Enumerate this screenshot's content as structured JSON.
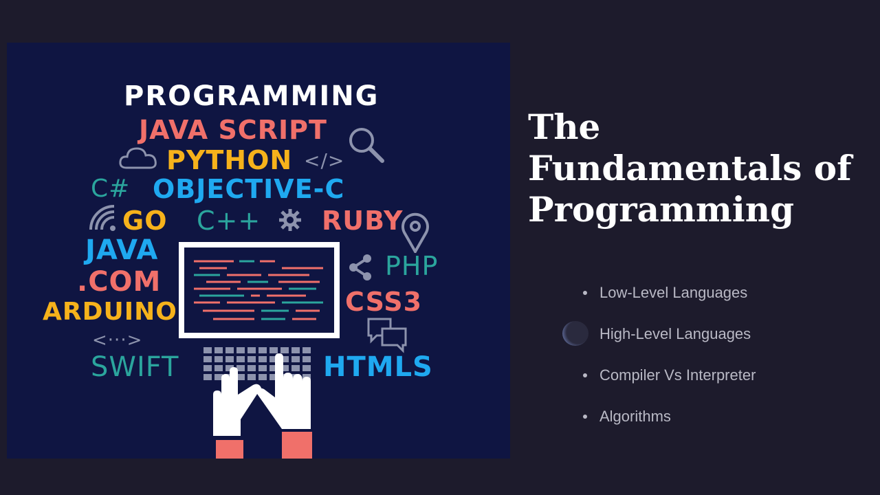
{
  "slide": {
    "title_lines": [
      "The",
      "Fundamentals of",
      "Programming"
    ],
    "bullets": [
      {
        "label": "Low-Level Languages"
      },
      {
        "label": "High-Level Languages"
      },
      {
        "label": "Compiler Vs Interpreter"
      },
      {
        "label": "Algorithms"
      }
    ]
  },
  "poster": {
    "heading": "PROGRAMMING",
    "words": {
      "javascript": "JAVA SCRIPT",
      "python": "PYTHON",
      "csharp": "C#",
      "objc": "OBJECTIVE-C",
      "go": "GO",
      "cpp": "C++",
      "ruby": "RUBY",
      "java": "JAVA",
      "php": "PHP",
      "dotcom": ".COM",
      "css3": "CSS3",
      "arduino": "ARDUINO",
      "swift": "SWIFT",
      "htmls": "HTMLS",
      "code_tag": "</>",
      "dots_tag": "<···>"
    },
    "colors": {
      "background": "#0f1542",
      "salmon": "#f0706a",
      "yellow": "#f6b21b",
      "blue": "#1fa9f0",
      "teal": "#2ba59d",
      "white": "#ffffff",
      "grey": "#8d93ad"
    },
    "icons": [
      "cloud-icon",
      "search-icon",
      "wifi-icon",
      "gear-icon",
      "location-pin-icon",
      "share-icon",
      "chat-bubbles-icon",
      "monitor-icon",
      "keyboard-icon",
      "hands-icon"
    ]
  }
}
